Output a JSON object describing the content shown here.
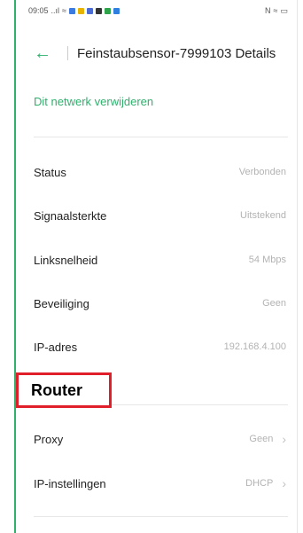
{
  "statusbar": {
    "time": "09:05",
    "signal": "..ıl",
    "wifi": "≈",
    "nfc": "N",
    "battery": "▭"
  },
  "header": {
    "title": "Feinstaubsensor-7999103 Details"
  },
  "actions": {
    "forget_label": "Dit netwerk verwijderen"
  },
  "details": [
    {
      "label": "Status",
      "value": "Verbonden"
    },
    {
      "label": "Signaalsterkte",
      "value": "Uitstekend"
    },
    {
      "label": "Linksnelheid",
      "value": "54 Mbps"
    },
    {
      "label": "Beveiliging",
      "value": "Geen"
    },
    {
      "label": "IP-adres",
      "value": "192.168.4.100"
    }
  ],
  "annotation": {
    "label": "Router"
  },
  "advanced": [
    {
      "label": "Proxy",
      "value": "Geen"
    },
    {
      "label": "IP-instellingen",
      "value": "DHCP"
    }
  ],
  "colors": {
    "accent": "#2fb06d",
    "annotation_border": "#e01f2a"
  }
}
